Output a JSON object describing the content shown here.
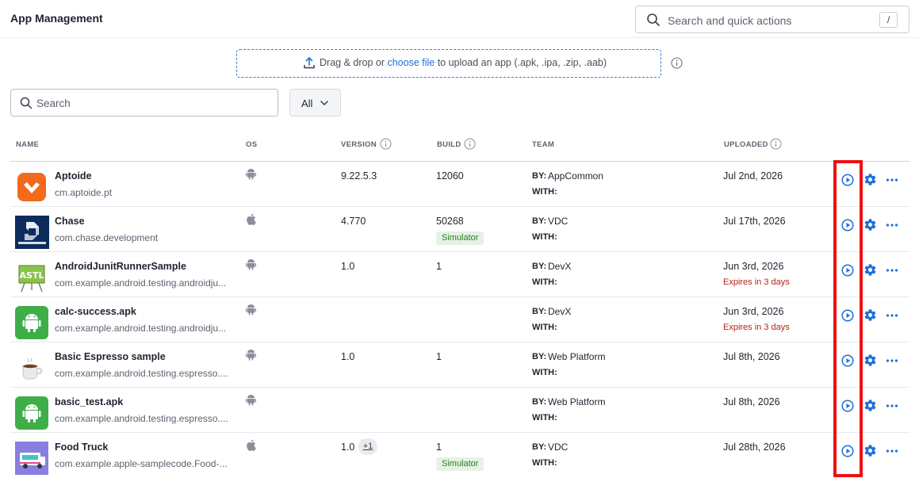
{
  "header": {
    "title": "App Management",
    "search_placeholder": "Search and quick actions",
    "search_shortcut": "/"
  },
  "upload": {
    "prefix": "Drag & drop or ",
    "link": "choose file",
    "suffix": " to upload an app (.apk, .ipa, .zip, .aab)"
  },
  "list_search": {
    "placeholder": "Search"
  },
  "filter": {
    "selected": "All"
  },
  "columns": {
    "name": "NAME",
    "os": "OS",
    "version": "VERSION",
    "build": "BUILD",
    "team": "TEAM",
    "uploaded": "UPLOADED"
  },
  "team_labels": {
    "by": "BY:",
    "with": "WITH:"
  },
  "apps": [
    {
      "name": "Aptoide",
      "bundle": "cm.aptoide.pt",
      "os": "android",
      "version": "9.22.5.3",
      "version_extra": "",
      "build": "12060",
      "badge": "",
      "by": "AppCommon",
      "uploaded": "Jul 2nd, 2026",
      "expires": ""
    },
    {
      "name": "Chase",
      "bundle": "com.chase.development",
      "os": "ios",
      "version": "4.770",
      "version_extra": "",
      "build": "50268",
      "badge": "Simulator",
      "by": "VDC",
      "uploaded": "Jul 17th, 2026",
      "expires": ""
    },
    {
      "name": "AndroidJunitRunnerSample",
      "bundle": "com.example.android.testing.androidju...",
      "os": "android",
      "version": "1.0",
      "version_extra": "",
      "build": "1",
      "badge": "",
      "by": "DevX",
      "uploaded": "Jun 3rd, 2026",
      "expires": "Expires in 3 days"
    },
    {
      "name": "calc-success.apk",
      "bundle": "com.example.android.testing.androidju...",
      "os": "android",
      "version": "",
      "version_extra": "",
      "build": "",
      "badge": "",
      "by": "DevX",
      "uploaded": "Jun 3rd, 2026",
      "expires": "Expires in 3 days"
    },
    {
      "name": "Basic Espresso sample",
      "bundle": "com.example.android.testing.espresso....",
      "os": "android",
      "version": "1.0",
      "version_extra": "",
      "build": "1",
      "badge": "",
      "by": "Web Platform",
      "uploaded": "Jul 8th, 2026",
      "expires": ""
    },
    {
      "name": "basic_test.apk",
      "bundle": "com.example.android.testing.espresso....",
      "os": "android",
      "version": "",
      "version_extra": "",
      "build": "",
      "badge": "",
      "by": "Web Platform",
      "uploaded": "Jul 8th, 2026",
      "expires": ""
    },
    {
      "name": "Food Truck",
      "bundle": "com.example.apple-samplecode.Food-...",
      "os": "ios",
      "version": "1.0",
      "version_extra": "+1",
      "build": "1",
      "badge": "Simulator",
      "by": "VDC",
      "uploaded": "Jul 28th, 2026",
      "expires": ""
    }
  ],
  "app_icons": [
    "aptoide-icon",
    "chase-icon",
    "astl-icon",
    "android-robot-icon",
    "coffee-cup-icon",
    "android-robot-icon",
    "food-truck-icon"
  ],
  "colors": {
    "accent": "#1f6fd6",
    "highlight": "#ee1111",
    "danger": "#b42318",
    "success_bg": "#e4f3e3",
    "success_text": "#2a7b2b"
  }
}
